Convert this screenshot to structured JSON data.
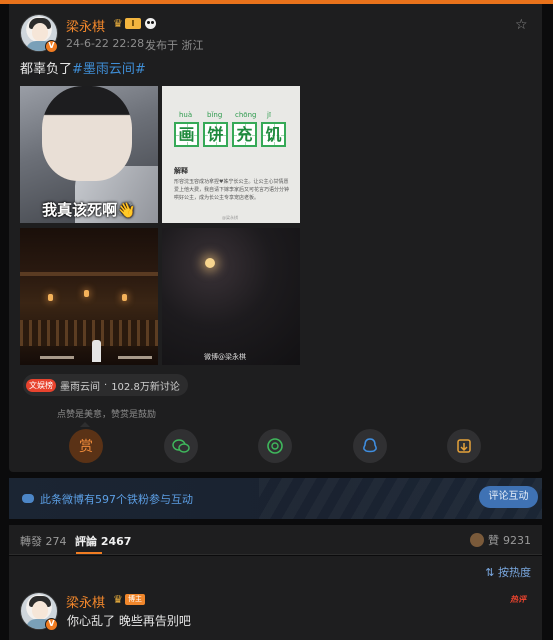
{
  "post": {
    "username": "梁永棋",
    "level_badge": "Ⅰ",
    "verified_mark": "V",
    "timestamp": "24-6-22 22:28",
    "location": "发布于 浙江",
    "text_prefix": "都辜负了",
    "hashtag": "#墨雨云间#",
    "images": {
      "img1_caption": "我真该死啊👋",
      "pinyin": [
        "huà",
        "bǐng",
        "chōng",
        "jī"
      ],
      "hanzi": [
        "画",
        "饼",
        "充",
        "饥"
      ],
      "explanation_title": "解释",
      "explanation_body": "形容沈玉容成功拿捏♥姝宁长公主。让公主心甘情愿爱上他大费，我自请下嫁李家后又可花言巧语分分钟哄好公主，成为长公主专享宠店老板。",
      "explanation_source": "@梁永棋",
      "watermark": "微博@梁永棋"
    },
    "topic": {
      "badge": "文娱榜",
      "name": "墨雨云间",
      "stats": "102.8万新讨论"
    },
    "reward_tip": "点赞是美意，赞赏是鼓励",
    "actions": [
      {
        "icon": "reward-icon",
        "label": "赏"
      },
      {
        "icon": "wechat-icon",
        "label": ""
      },
      {
        "icon": "moments-icon",
        "label": ""
      },
      {
        "icon": "qq-icon",
        "label": ""
      },
      {
        "icon": "save-image-icon",
        "label": ""
      }
    ]
  },
  "fans": {
    "text": "此条微博有597个铁粉参与互动",
    "button": "评论互动"
  },
  "tabs": {
    "repost_label": "轉發",
    "repost_count": "274",
    "comment_label": "評論",
    "comment_count": "2467",
    "like_label": "贊",
    "like_count": "9231"
  },
  "comments": {
    "sort_label": "按热度",
    "hot_tag": "热评",
    "items": [
      {
        "username": "梁永棋",
        "badge": "博主",
        "text": "你心乱了 晚些再告别吧"
      }
    ]
  },
  "colors": {
    "accent": "#f07c22",
    "link": "#3f8ed6",
    "background": "#0b0b0c",
    "card": "#1e1e1f"
  }
}
